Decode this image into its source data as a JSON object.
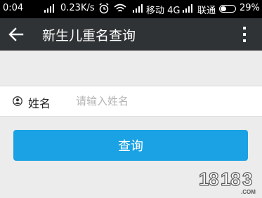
{
  "status_bar": {
    "time": "0:04",
    "speed": "0.23K/s",
    "carrier1": "移动 4G",
    "carrier2": "联通",
    "battery": "29%"
  },
  "app_bar": {
    "title": "新生儿重名查询",
    "back_icon": "arrow-left-icon",
    "menu_icon": "more-vert-icon"
  },
  "form": {
    "name_label": "姓名",
    "name_placeholder": "请输入姓名",
    "name_value": "",
    "user_icon": "user-icon"
  },
  "query_button": {
    "label": "查询",
    "color": "#1aa2e4"
  },
  "watermark": {
    "text": "18183",
    "sub": ".COM"
  }
}
